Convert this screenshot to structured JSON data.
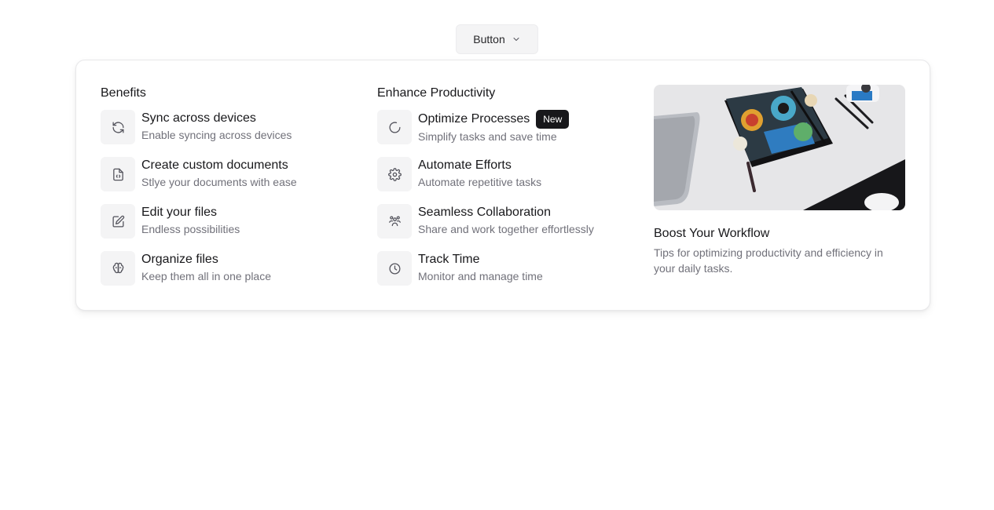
{
  "trigger": {
    "label": "Button",
    "icon": "chevron-down-icon"
  },
  "benefits": {
    "title": "Benefits",
    "items": [
      {
        "title": "Sync across devices",
        "description": "Enable syncing across devices",
        "icon": "sync-icon"
      },
      {
        "title": "Create custom documents",
        "description": "Stlye your documents with ease",
        "icon": "document-icon"
      },
      {
        "title": "Edit your files",
        "description": "Endless possibilities",
        "icon": "edit-icon"
      },
      {
        "title": "Organize files",
        "description": "Keep them all in one place",
        "icon": "brain-icon"
      }
    ]
  },
  "productivity": {
    "title": "Enhance Productivity",
    "items": [
      {
        "title": "Optimize Processes",
        "description": "Simplify tasks and save time",
        "icon": "loader-icon",
        "badge": "New"
      },
      {
        "title": "Automate Efforts",
        "description": "Automate repetitive tasks",
        "icon": "gear-icon"
      },
      {
        "title": "Seamless Collaboration",
        "description": "Share and work together effortlessly",
        "icon": "users-icon"
      },
      {
        "title": "Track Time",
        "description": "Monitor and manage time",
        "icon": "clock-icon"
      }
    ]
  },
  "feature": {
    "title": "Boost Your Workflow",
    "description": "Tips for optimizing productivity and efficiency in your daily tasks.",
    "image": "notebook-with-pencils-photo"
  },
  "colors": {
    "text": "#18181b",
    "muted": "#71717a",
    "icon_bg": "#f4f4f5",
    "badge_bg": "#18181b"
  }
}
